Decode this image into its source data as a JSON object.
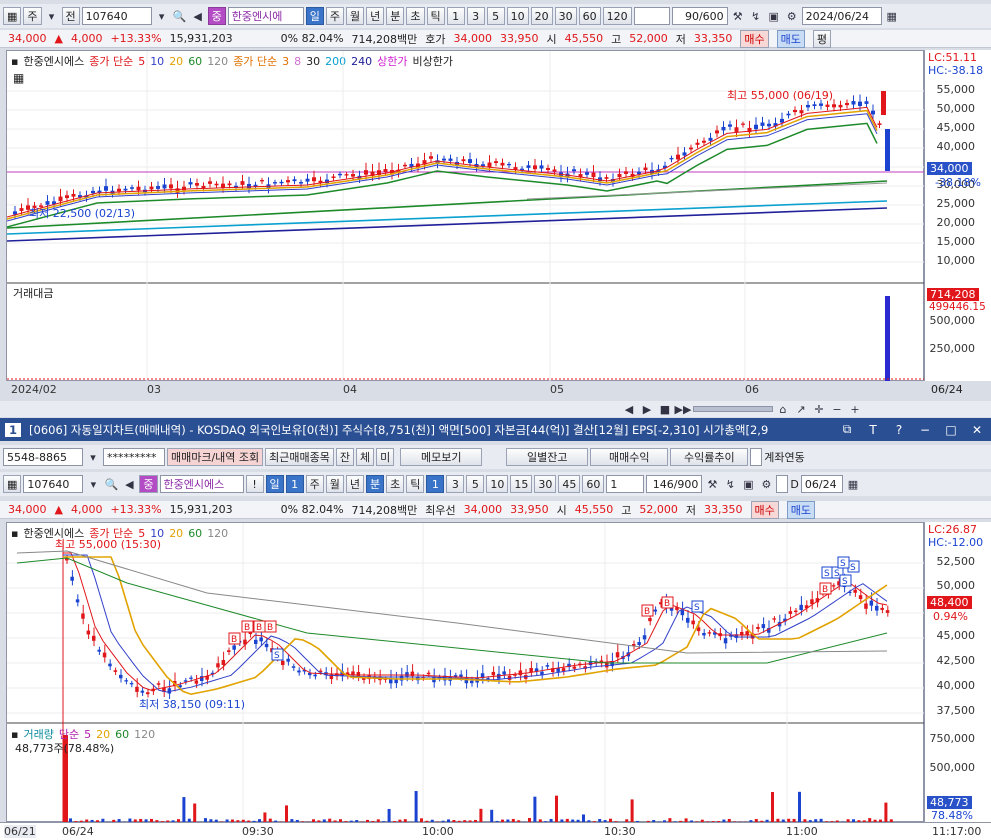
{
  "top_toolbar": {
    "grid_icon": "grid-icon",
    "mode1": "주",
    "mode2": "전",
    "code": "107640",
    "name": "한중엔시에",
    "name_badge": "중",
    "periods": [
      "일",
      "주",
      "월",
      "년",
      "분",
      "초",
      "틱"
    ],
    "numbers": [
      "1",
      "3",
      "5",
      "10",
      "20",
      "30",
      "60",
      "120"
    ],
    "count": "90/600",
    "date": "2024/06/24"
  },
  "top_info": {
    "price": "34,000",
    "arrow": "▲",
    "change": "4,000",
    "rate": "+13.33%",
    "volume": "15,931,203",
    "pct": "0% 82.04%",
    "amount": "714,208백만",
    "hoga_label": "호가",
    "hoga1": "34,000",
    "hoga2": "33,950",
    "open_label": "시",
    "open": "45,550",
    "high_label": "고",
    "high": "52,000",
    "low_label": "저",
    "low": "33,350",
    "buy": "매수",
    "sell": "매도",
    "flat": "평"
  },
  "top_chart": {
    "legend": {
      "name": "한중엔시에스",
      "ma_label": "종가 단순",
      "ma_vals": [
        "5",
        "10",
        "20",
        "60",
        "120"
      ],
      "ma2_label": "종가 단순",
      "ma2_vals": [
        "3",
        "8",
        "30",
        "200",
        "240"
      ],
      "upper": "상한가",
      "lower": "비상한가"
    },
    "y_labels": [
      "55,000",
      "50,000",
      "45,000",
      "40,000",
      "35,000",
      "30,000",
      "25,000",
      "20,000",
      "15,000",
      "10,000"
    ],
    "lc": "LC:51.11",
    "hc": "HC:-38.18",
    "price_tag": "34,000",
    "price_pct": "-38.18%",
    "high_note": "최고 55,000 (06/19)",
    "low_note": "최저 22,500 (02/13)",
    "vol_title": "거래대금",
    "vol_labels": [
      "500,000",
      "250,000"
    ],
    "vol_tag": "714,208",
    "vol_tag2": "499446.15",
    "x_labels": [
      "2024/02",
      "03",
      "04",
      "05",
      "06",
      "06/24"
    ]
  },
  "main_title": {
    "index": "1",
    "text": "[0606] 자동일지차트(매매내역) - KOSDAQ 외국인보유[0(천)] 주식수[8,751(천)] 액면[500] 자본금[44(억)] 결산[12월] EPS[-2,310] 시가총액[2,9"
  },
  "bottom_bar1": {
    "account": "5548-8865",
    "password": "*********",
    "mark": "매매마크/내역 조회",
    "recent": "최근매매종목",
    "tabs": [
      "잔",
      "체",
      "미"
    ],
    "memo": "메모보기",
    "daily": "일별잔고",
    "profit": "매매수익",
    "trend": "수익률추이",
    "link": "계좌연동"
  },
  "bottom_toolbar": {
    "code": "107640",
    "name": "한중엔시에스",
    "day": "일",
    "day_n": "1",
    "periods": [
      "주",
      "월",
      "년",
      "분",
      "초",
      "틱"
    ],
    "numbers": [
      "1",
      "3",
      "5",
      "10",
      "15",
      "30",
      "45",
      "60"
    ],
    "sel": "1",
    "count": "146/900",
    "d_label": "D",
    "date": "06/24"
  },
  "bottom_info": {
    "price": "34,000",
    "arrow": "▲",
    "change": "4,000",
    "rate": "+13.33%",
    "volume": "15,931,203",
    "pct": "0% 82.04%",
    "amount": "714,208백만",
    "best": "최우선",
    "b1": "34,000",
    "b2": "33,950",
    "open_label": "시",
    "open": "45,550",
    "high_label": "고",
    "high": "52,000",
    "low_label": "저",
    "low": "33,350",
    "buy": "매수",
    "sell": "매도"
  },
  "bottom_chart": {
    "legend": {
      "name": "한중엔시에스",
      "ma_label": "종가 단순",
      "ma_vals": [
        "5",
        "10",
        "20",
        "60",
        "120"
      ]
    },
    "y_labels": [
      "52,500",
      "50,000",
      "47,500",
      "45,000",
      "42,500",
      "40,000",
      "37,500"
    ],
    "lc": "LC:26.87",
    "hc": "HC:-12.00",
    "price_tag": "48,400",
    "price_pct": "0.94%",
    "high_note": "최고 55,000 (15:30)",
    "low_note": "최저 38,150 (09:11)",
    "vol_legend": {
      "label": "거래량",
      "ma_label": "단순",
      "ma_vals": [
        "5",
        "20",
        "60",
        "120"
      ],
      "value": "48,773주(78.48%)"
    },
    "vol_labels": [
      "750,000",
      "500,000",
      "250,000"
    ],
    "vol_tag": "48,773",
    "vol_tag2": "78.48%",
    "x_labels": [
      "06/21",
      "06/24",
      "09:30",
      "10:00",
      "10:30",
      "11:00",
      "11:17:00"
    ]
  }
}
